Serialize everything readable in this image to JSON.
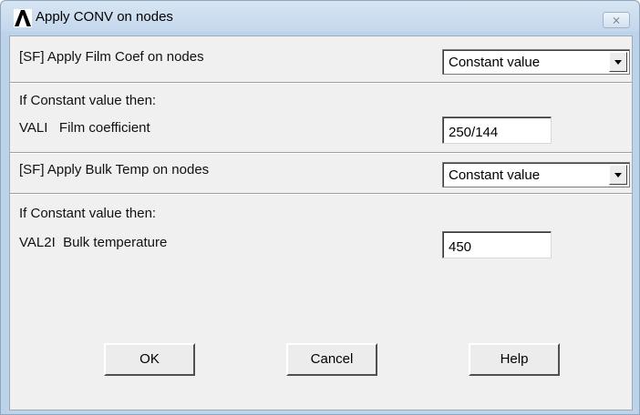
{
  "window": {
    "title": "Apply CONV on nodes",
    "close_glyph": "⨯",
    "app_icon": "ansys-logo-icon"
  },
  "film": {
    "label": "[SF] Apply Film Coef on nodes",
    "dropdown_value": "Constant value",
    "condition_label": "If Constant value then:",
    "field_label": "VALI   Film coefficient",
    "field_value": "250/144"
  },
  "bulk": {
    "label": "[SF] Apply Bulk Temp on nodes",
    "dropdown_value": "Constant value",
    "condition_label": "If Constant value then:",
    "field_label": "VAL2I  Bulk temperature",
    "field_value": "450"
  },
  "buttons": {
    "ok": "OK",
    "cancel": "Cancel",
    "help": "Help"
  }
}
